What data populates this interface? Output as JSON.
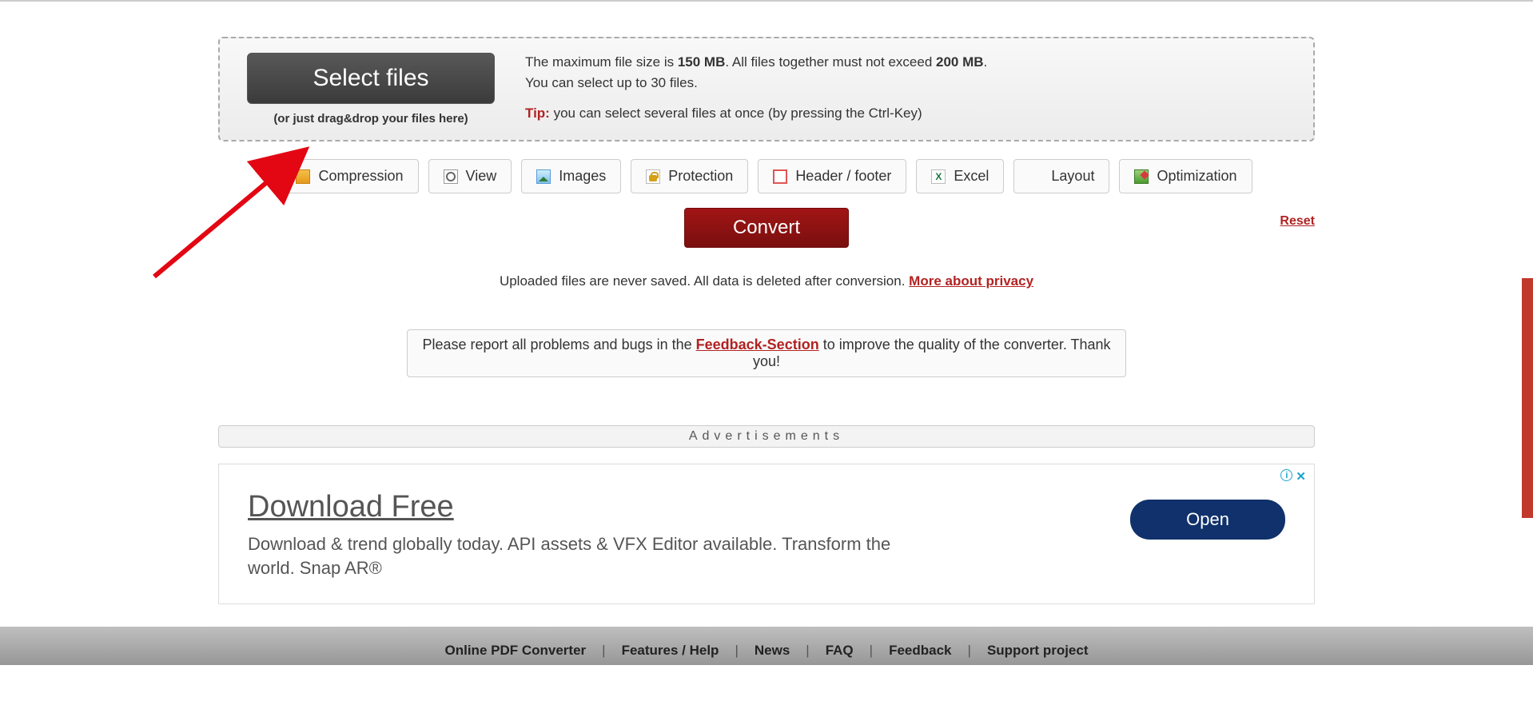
{
  "dropzone": {
    "select_label": "Select files",
    "dd_hint": "(or just drag&drop your files here)",
    "max_line_pre": "The maximum file size is ",
    "max_size": "150 MB",
    "max_line_mid": ". All files together must not exceed ",
    "max_total": "200 MB",
    "max_line_post": ".",
    "count_line": "You can select up to 30 files.",
    "tip_label": "Tip:",
    "tip_text": " you can select several files at once (by pressing the Ctrl-Key)"
  },
  "tabs": [
    {
      "label": "Compression",
      "icon": "compression-icon"
    },
    {
      "label": "View",
      "icon": "view-icon"
    },
    {
      "label": "Images",
      "icon": "images-icon"
    },
    {
      "label": "Protection",
      "icon": "protection-icon"
    },
    {
      "label": "Header / footer",
      "icon": "header-footer-icon"
    },
    {
      "label": "Excel",
      "icon": "excel-icon"
    },
    {
      "label": "Layout",
      "icon": "layout-icon"
    },
    {
      "label": "Optimization",
      "icon": "optimization-icon"
    }
  ],
  "actions": {
    "convert": "Convert",
    "reset": "Reset"
  },
  "privacy": {
    "text": "Uploaded files are never saved. All data is deleted after conversion. ",
    "link": "More about privacy"
  },
  "feedback": {
    "pre": "Please report all problems and bugs in the ",
    "link": "Feedback-Section",
    "post": " to improve the quality of the converter. Thank you!"
  },
  "ads_label": "Advertisements",
  "ad": {
    "title": "Download Free",
    "desc": "Download & trend globally today. API assets & VFX Editor available. Transform the world. Snap AR®",
    "cta": "Open"
  },
  "footer": {
    "items": [
      "Online PDF Converter",
      "Features / Help",
      "News",
      "FAQ",
      "Feedback",
      "Support project"
    ]
  }
}
